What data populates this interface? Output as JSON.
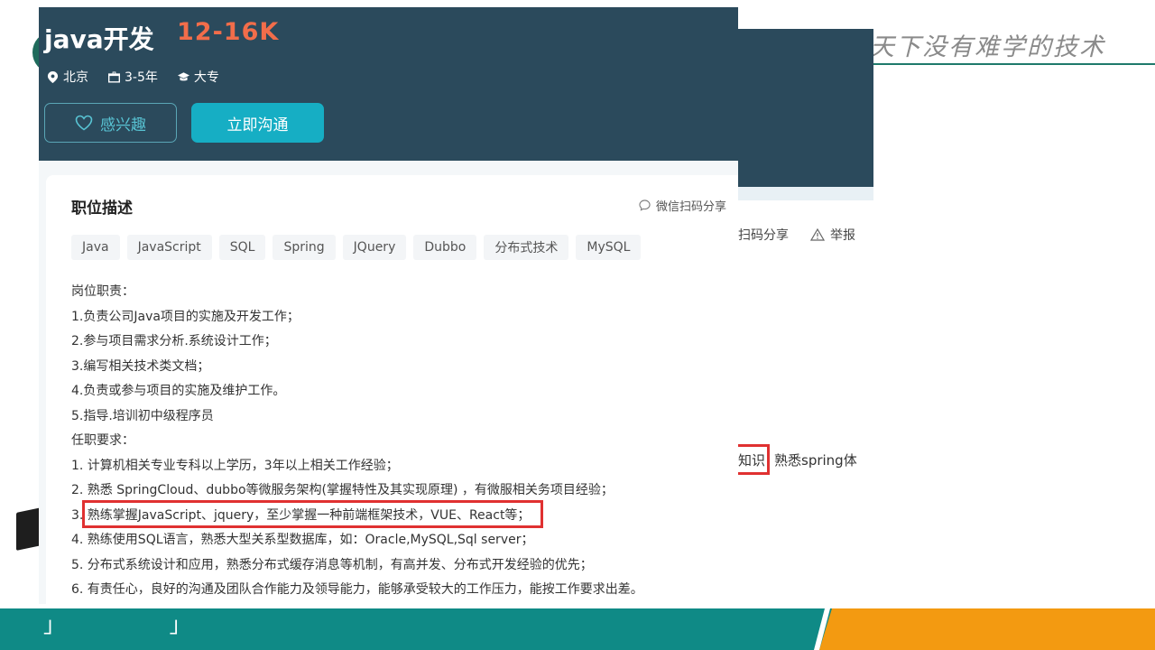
{
  "slide": {
    "slogan": "天下没有难学的技术",
    "marks": "」 」"
  },
  "back_window": {
    "share_partial": "扫码分享",
    "report": "举报",
    "highlight_text": "知识，",
    "rest_text": "熟悉spring体"
  },
  "job": {
    "title": "java开发",
    "salary": "12-16K",
    "location": "北京",
    "experience": "3-5年",
    "education": "大专",
    "interest_button": "感兴趣",
    "chat_button": "立即沟通",
    "section_title": "职位描述",
    "share": "微信扫码分享",
    "tags": [
      "Java",
      "JavaScript",
      "SQL",
      "Spring",
      "JQuery",
      "Dubbo",
      "分布式技术",
      "MySQL"
    ],
    "lines": [
      "岗位职责：",
      "1.负责公司Java项目的实施及开发工作；",
      "2.参与项目需求分析.系统设计工作；",
      "3.编写相关技术类文档；",
      "4.负责或参与项目的实施及维护工作。",
      "5.指导.培训初中级程序员",
      "任职要求：",
      "1. 计算机相关专业专科以上学历，3年以上相关工作经验；",
      "2. 熟悉 SpringCloud、dubbo等微服务架构(掌握特性及其实现原理) ，有微服相关务项目经验；",
      "3. 熟练掌握JavaScript、jquery，至少掌握一种前端框架技术，VUE、React等；",
      "4. 熟练使用SQL语言，熟悉大型关系型数据库，如：Oracle,MySQL,Sql server；",
      "5. 分布式系统设计和应用，熟悉分布式缓存消息等机制，有高并发、分布式开发经验的优先；",
      "6. 有责任心，良好的沟通及团队合作能力及领导能力，能够承受较大的工作压力，能按工作要求出差。"
    ]
  },
  "colors": {
    "header_bg": "#2b4a5c",
    "salary": "#f26d4a",
    "chat_button": "#16aec4",
    "highlight_border": "#e03131",
    "footer_teal": "#0f8a86",
    "footer_orange": "#f39a11"
  }
}
